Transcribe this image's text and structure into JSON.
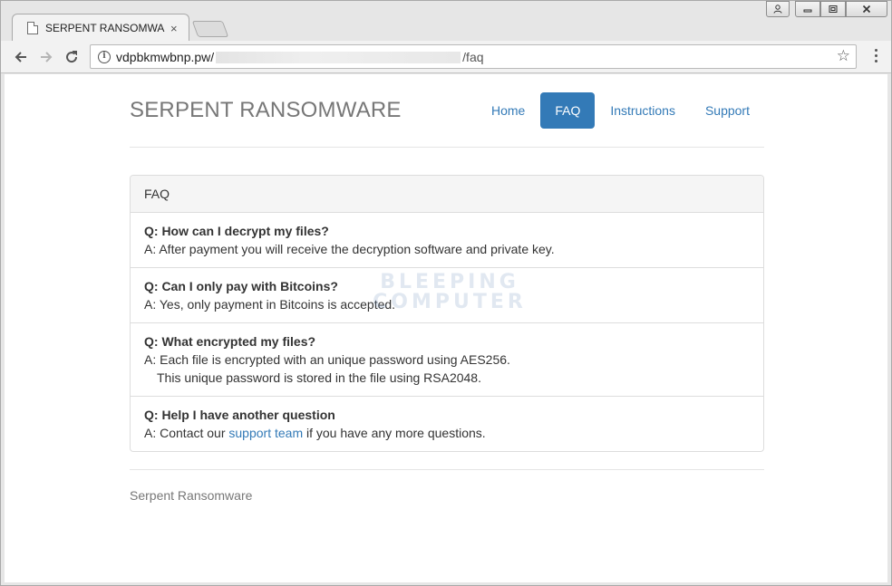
{
  "browser": {
    "tab_title": "SERPENT RANSOMWARE",
    "tab_close": "×",
    "url_host": "vdpbkmwbnp.pw/",
    "url_path": "/faq",
    "info_icon": "i",
    "star_icon": "☆"
  },
  "site": {
    "brand": "SERPENT RANSOMWARE",
    "nav": [
      {
        "label": "Home",
        "active": false
      },
      {
        "label": "FAQ",
        "active": true
      },
      {
        "label": "Instructions",
        "active": false
      },
      {
        "label": "Support",
        "active": false
      }
    ]
  },
  "faq": {
    "heading": "FAQ",
    "items": [
      {
        "question": "Q: How can I decrypt my files?",
        "answer": "A: After payment you will receive the decryption software and private key."
      },
      {
        "question": "Q: Can I only pay with Bitcoins?",
        "answer": "A: Yes, only payment in Bitcoins is accepted."
      },
      {
        "question": "Q: What encrypted my files?",
        "answer": "A: Each file is encrypted with an unique password using AES256.",
        "answer_line2": "This unique password is stored in the file using RSA2048."
      },
      {
        "question": "Q: Help I have another question",
        "answer_prefix": "A: Contact our ",
        "answer_link": "support team",
        "answer_suffix": " if you have any more questions."
      }
    ]
  },
  "footer": {
    "text": "Serpent Ransomware"
  },
  "watermark": {
    "line1": "BLEEPING",
    "line2": "COMPUTER"
  },
  "colors": {
    "link": "#337ab7",
    "brand_text": "#777777"
  }
}
